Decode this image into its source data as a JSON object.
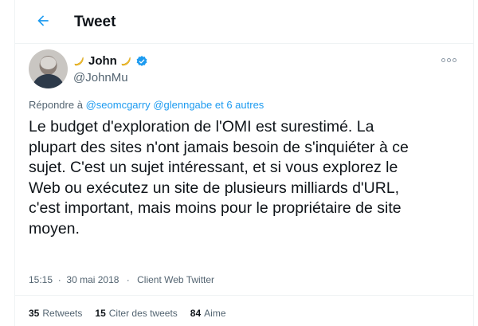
{
  "header": {
    "title": "Tweet",
    "back_icon": "back-arrow-icon",
    "accent": "#1d9bf0"
  },
  "tweet": {
    "author": {
      "name": "John",
      "handle": "@JohnMu",
      "verified": true,
      "name_emoji": "banana"
    },
    "reply_prefix": "Répondre à",
    "reply_to": [
      "@seomcgarry",
      "@glenngabe"
    ],
    "reply_suffix": "et 6 autres",
    "text_lines": [
      "Le budget d'exploration de l'OMI est surestimé. La",
      "plupart des sites n'ont jamais besoin de s'inquiéter à ce",
      "sujet. C'est un sujet intéressant, et si vous explorez le",
      "Web ou exécutez un site de plusieurs milliards d'URL,",
      "c'est important, mais moins pour le propriétaire de site",
      "moyen."
    ],
    "time": "15:15",
    "date": "30 mai 2018",
    "dot": "·",
    "source": "Client Web Twitter"
  },
  "stats": {
    "retweets": {
      "count": "35",
      "label": "Retweets"
    },
    "quotes": {
      "count": "15",
      "label": "Citer des tweets"
    },
    "likes": {
      "count": "84",
      "label": "Aime"
    }
  }
}
